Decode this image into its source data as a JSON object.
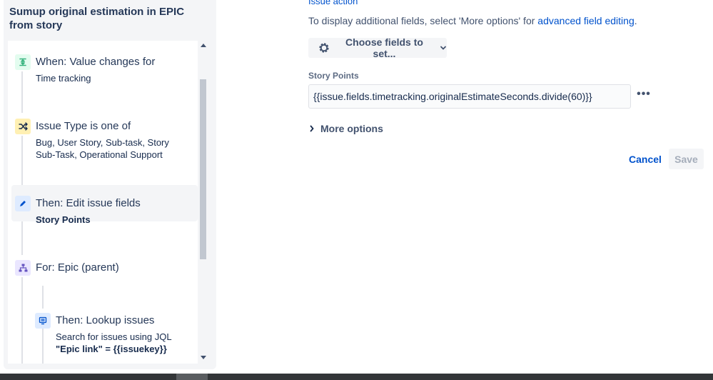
{
  "rule": {
    "title": "Sumup original estimation in EPIC from story"
  },
  "components": [
    {
      "name": "trigger",
      "icon": "trigger-icon",
      "heading": "When: Value changes for",
      "detail": "Time tracking",
      "color": "#36B37E",
      "bg": "#E3FCEF"
    },
    {
      "name": "condition",
      "icon": "shuffle-icon",
      "heading": "Issue Type is one of",
      "detail": "Bug, User Story, Sub-task, Story Sub-Task, Operational Support",
      "color": "#FFAB00",
      "bg": "#FFF0B3"
    },
    {
      "name": "action-edit",
      "icon": "pencil-icon",
      "heading": "Then: Edit issue fields",
      "detail": "Story Points",
      "color": "#0065FF",
      "bg": "#DEEBFF",
      "selected": true
    },
    {
      "name": "branch",
      "icon": "hierarchy-icon",
      "heading": "For: Epic (parent)",
      "detail": "",
      "color": "#6554C0",
      "bg": "#EAE6FF"
    },
    {
      "name": "action-lookup",
      "icon": "lookup-icon",
      "heading": "Then: Lookup issues",
      "detail_line1": "Search for issues using JQL",
      "detail_line2": "\"Epic link\" = {{issuekey}}",
      "color": "#0065FF",
      "bg": "#DEEBFF"
    }
  ],
  "form": {
    "top_link": "Issue action",
    "hint_prefix": "To display additional fields, select 'More options' for ",
    "hint_link": "advanced field editing",
    "hint_suffix": ".",
    "choose_fields_label": "Choose fields to set...",
    "field_label": "Story Points",
    "field_value": "{{issue.fields.timetracking.originalEstimateSeconds.divide(60)}}",
    "more_options_label": "More options",
    "cancel_label": "Cancel",
    "save_label": "Save"
  },
  "colors": {
    "link": "#0052CC",
    "panel_bg": "#F4F5F7"
  }
}
